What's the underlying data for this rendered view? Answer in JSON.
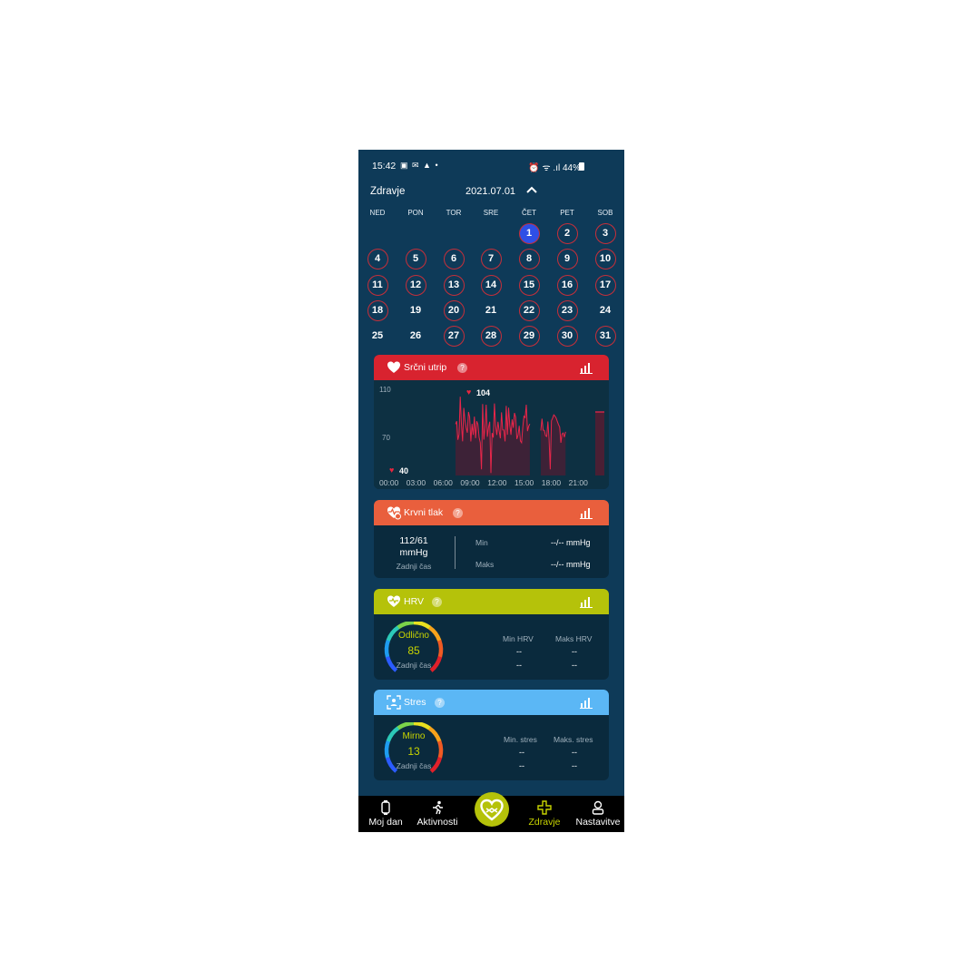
{
  "status": {
    "time": "15:42",
    "battery": "44%"
  },
  "header": {
    "title": "Zdravje",
    "date": "2021.07.01"
  },
  "calendar": {
    "weekdays": [
      "NED",
      "PON",
      "TOR",
      "SRE",
      "ČET",
      "PET",
      "SOB"
    ],
    "days": [
      {
        "n": "1",
        "ring": true,
        "sel": true
      },
      {
        "n": "2",
        "ring": true
      },
      {
        "n": "3",
        "ring": true
      },
      {
        "n": "4",
        "ring": true
      },
      {
        "n": "5",
        "ring": true
      },
      {
        "n": "6",
        "ring": true
      },
      {
        "n": "7",
        "ring": true
      },
      {
        "n": "8",
        "ring": true
      },
      {
        "n": "9",
        "ring": true
      },
      {
        "n": "10",
        "ring": true
      },
      {
        "n": "11",
        "ring": true
      },
      {
        "n": "12",
        "ring": true
      },
      {
        "n": "13",
        "ring": true
      },
      {
        "n": "14",
        "ring": true
      },
      {
        "n": "15",
        "ring": true
      },
      {
        "n": "16",
        "ring": true
      },
      {
        "n": "17",
        "ring": true
      },
      {
        "n": "18",
        "ring": true
      },
      {
        "n": "19",
        "ring": false
      },
      {
        "n": "20",
        "ring": true
      },
      {
        "n": "21",
        "ring": false
      },
      {
        "n": "22",
        "ring": true
      },
      {
        "n": "23",
        "ring": true
      },
      {
        "n": "24",
        "ring": false
      },
      {
        "n": "25",
        "ring": false
      },
      {
        "n": "26",
        "ring": false
      },
      {
        "n": "27",
        "ring": true
      },
      {
        "n": "28",
        "ring": true
      },
      {
        "n": "29",
        "ring": true
      },
      {
        "n": "30",
        "ring": true
      },
      {
        "n": "31",
        "ring": true
      }
    ]
  },
  "heart": {
    "title": "Srčni utrip",
    "color": "#d8232f",
    "y_top": "110",
    "y_mid": "70",
    "max": "104",
    "min": "40",
    "x_labels": [
      "00:00",
      "03:00",
      "06:00",
      "09:00",
      "12:00",
      "15:00",
      "18:00",
      "21:00"
    ]
  },
  "bp": {
    "title": "Krvni tlak",
    "color": "#e95f3d",
    "value": "112/61",
    "unit": "mmHg",
    "last": "Zadnji čas",
    "min_label": "Min",
    "min_value": "--/-- mmHg",
    "max_label": "Maks",
    "max_value": "--/-- mmHg"
  },
  "hrv": {
    "title": "HRV",
    "color": "#b5c20a",
    "status": "Odlično",
    "value": "85",
    "last": "Zadnji čas",
    "col1": "Min HRV",
    "col2": "Maks HRV",
    "dash": "--"
  },
  "stress": {
    "title": "Stres",
    "color": "#5bb7f5",
    "status": "Mirno",
    "value": "13",
    "last": "Zadnji čas",
    "col1": "Min. stres",
    "col2": "Maks. stres",
    "dash": "--"
  },
  "nav": {
    "items": [
      "Moj dan",
      "Aktivnosti",
      "Zdravje",
      "Nastavitve"
    ],
    "active_color": "#c8d400"
  }
}
